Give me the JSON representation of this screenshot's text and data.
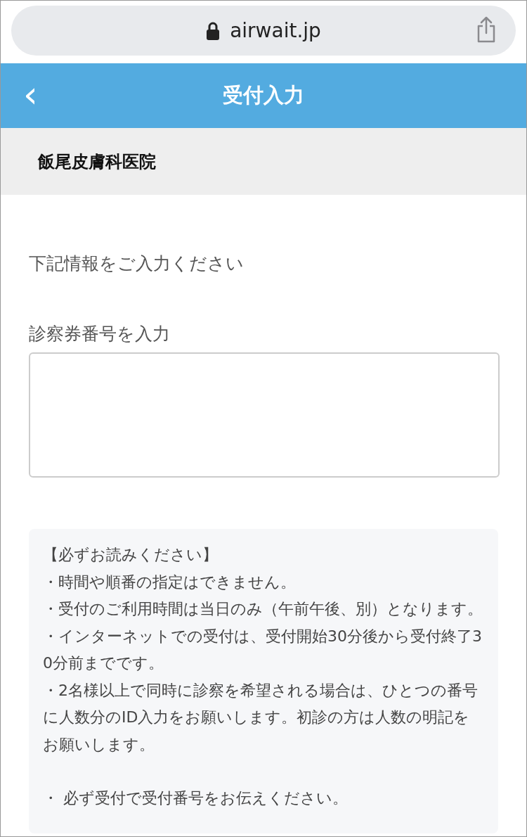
{
  "browser": {
    "url": "airwait.jp"
  },
  "header": {
    "back": "‹",
    "title": "受付入力"
  },
  "clinic": {
    "name": "飯尾皮膚科医院"
  },
  "form": {
    "intro": "下記情報をご入力ください",
    "field_label": "診察券番号を入力"
  },
  "notice": {
    "heading": "【必ずお読みください】",
    "items": [
      "・時間や順番の指定はできません。",
      "・受付のご利用時間は当日のみ（午前午後、別）となります。",
      "・インターネットでの受付は、受付開始30分後から受付終了30分前までです。",
      "・2名様以上で同時に診察を希望される場合は、ひとつの番号に人数分のID入力をお願いします。初診の方は人数の明記をお願いします。"
    ],
    "footer": "・ 必ず受付で受付番号をお伝えください。"
  }
}
